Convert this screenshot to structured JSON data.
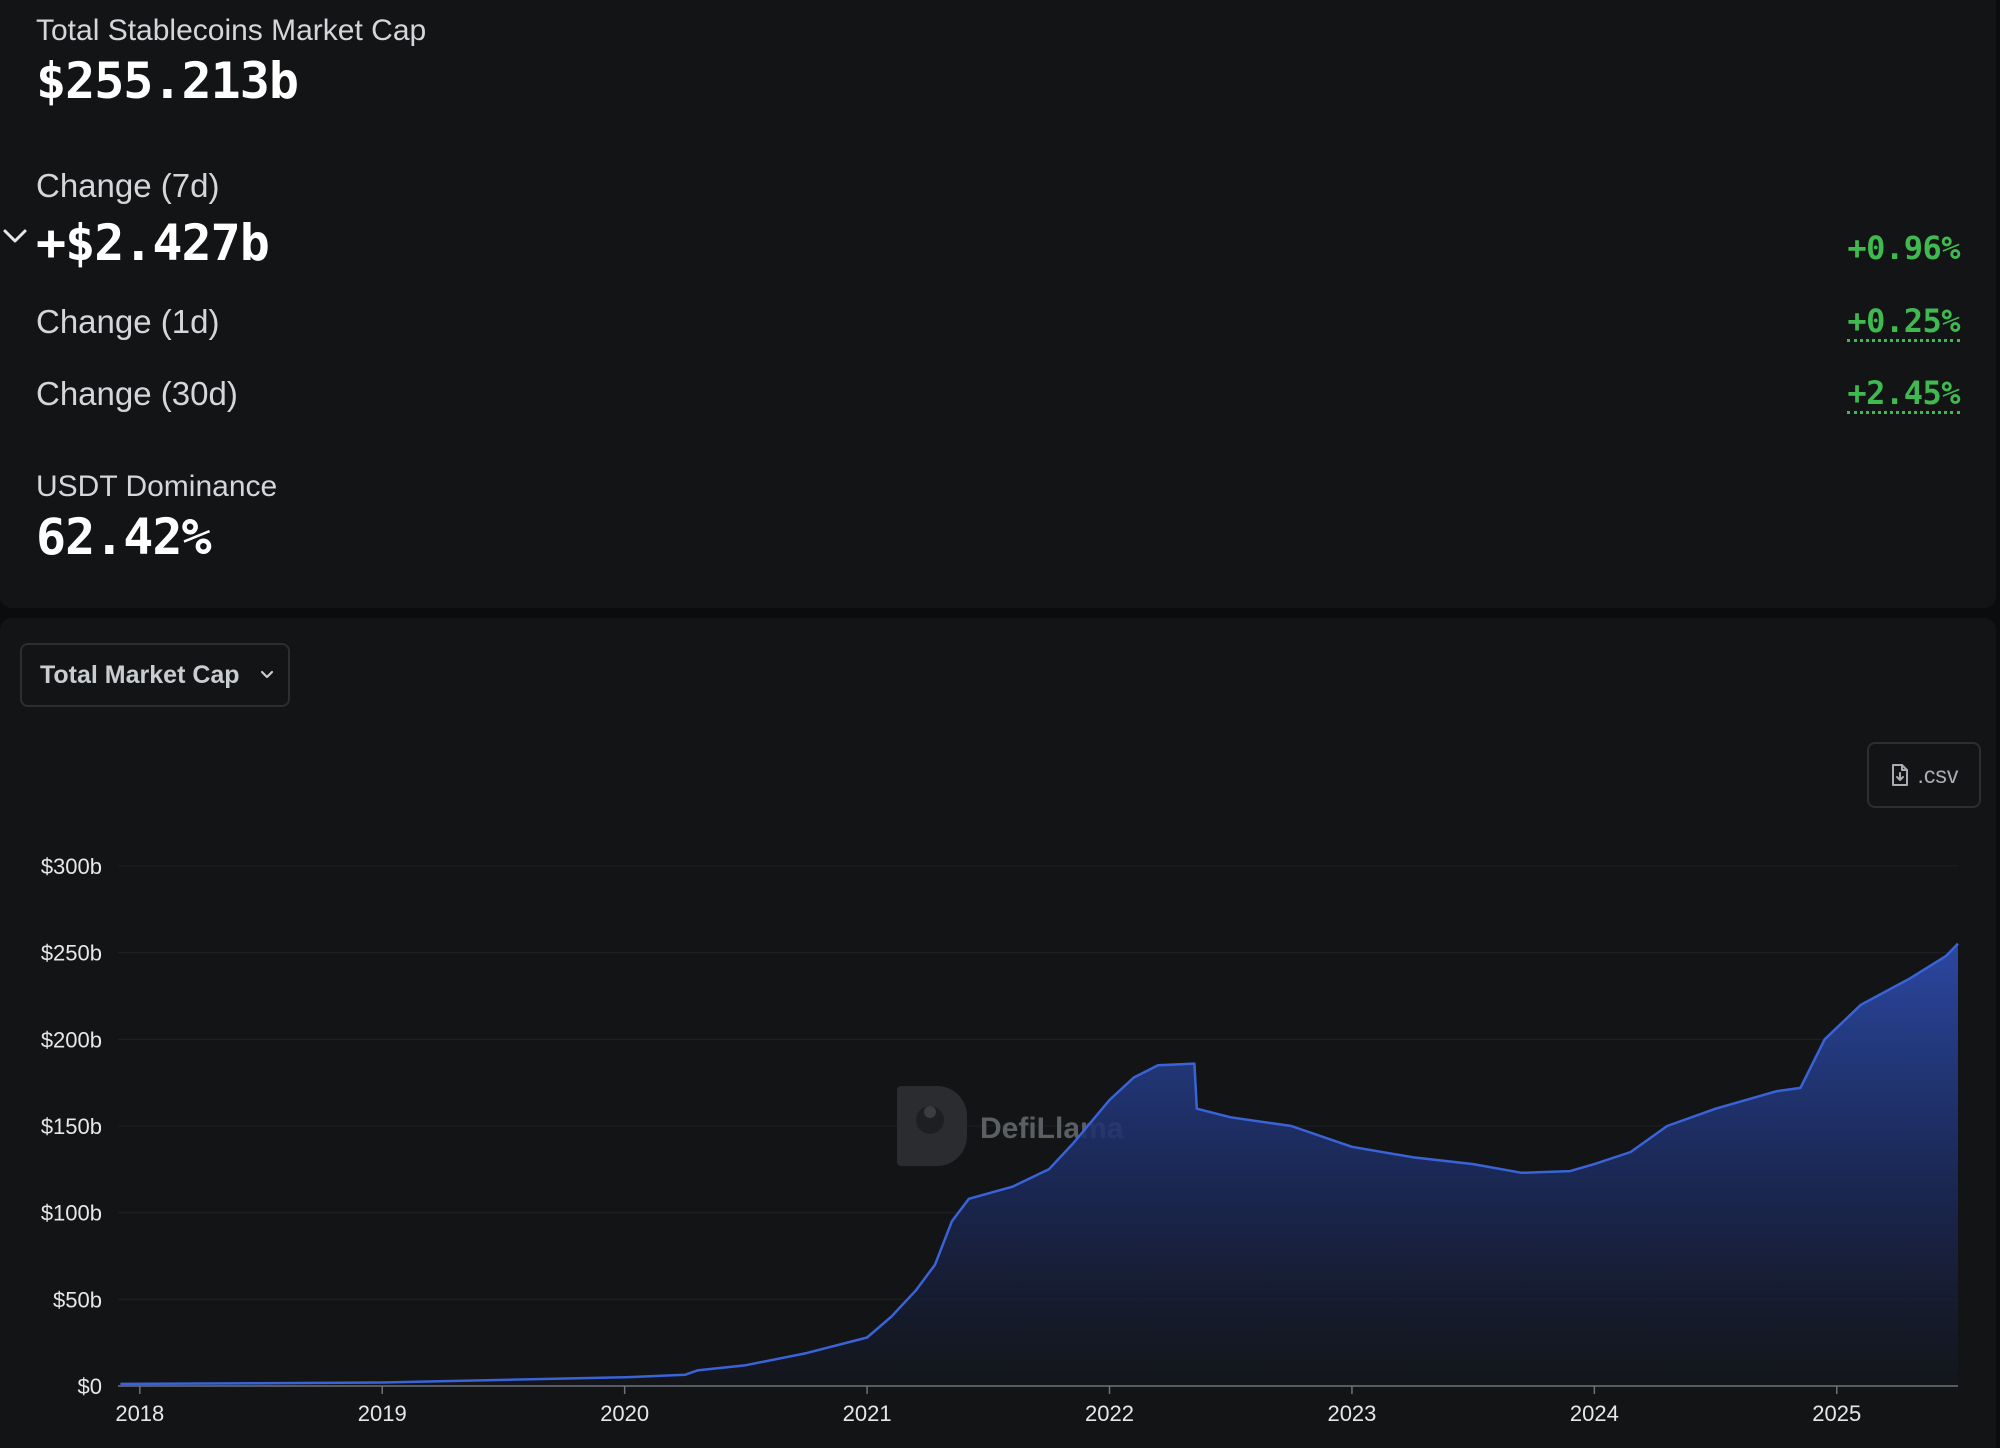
{
  "stats": {
    "total_label": "Total Stablecoins Market Cap",
    "total_value": "$255.213b",
    "change_7d_label": "Change (7d)",
    "change_7d_value": "+$2.427b",
    "change_7d_pct": "+0.96%",
    "change_1d_label": "Change (1d)",
    "change_1d_pct": "+0.25%",
    "change_30d_label": "Change (30d)",
    "change_30d_pct": "+2.45%",
    "dominance_label": "USDT Dominance",
    "dominance_value": "62.42%"
  },
  "controls": {
    "metric_select": "Total Market Cap",
    "csv_label": ".csv"
  },
  "watermark": "DefiLlama",
  "colors": {
    "positive": "#3fb950",
    "line": "#3a63d8",
    "area_top": "#2c4aa8",
    "background": "#131416"
  },
  "icons": [
    "chevron-down-icon",
    "file-download-icon",
    "llama-logo-icon"
  ],
  "chart_data": {
    "type": "area",
    "x_unit": "year",
    "y_unit": "$b",
    "ylim": [
      0,
      300
    ],
    "y_ticks": [
      0,
      50,
      100,
      150,
      200,
      250,
      300
    ],
    "y_tick_labels": [
      "$0",
      "$50b",
      "$100b",
      "$150b",
      "$200b",
      "$250b",
      "$300b"
    ],
    "x_ticks": [
      "2018",
      "2019",
      "2020",
      "2021",
      "2022",
      "2023",
      "2024",
      "2025"
    ],
    "grid": true,
    "series": [
      {
        "points": [
          [
            2017.92,
            1.2
          ],
          [
            2018.5,
            1.6
          ],
          [
            2019.0,
            2.0
          ],
          [
            2019.5,
            3.5
          ],
          [
            2020.0,
            5.0
          ],
          [
            2020.25,
            6.5
          ],
          [
            2020.3,
            9.0
          ],
          [
            2020.5,
            12.0
          ],
          [
            2020.75,
            19.0
          ],
          [
            2021.0,
            28.0
          ],
          [
            2021.1,
            40.0
          ],
          [
            2021.2,
            55.0
          ],
          [
            2021.28,
            70.0
          ],
          [
            2021.35,
            95.0
          ],
          [
            2021.42,
            108.0
          ],
          [
            2021.6,
            115.0
          ],
          [
            2021.75,
            125.0
          ],
          [
            2021.85,
            140.0
          ],
          [
            2022.0,
            165.0
          ],
          [
            2022.1,
            178.0
          ],
          [
            2022.2,
            185.0
          ],
          [
            2022.35,
            186.0
          ],
          [
            2022.36,
            160.0
          ],
          [
            2022.5,
            155.0
          ],
          [
            2022.75,
            150.0
          ],
          [
            2023.0,
            138.0
          ],
          [
            2023.25,
            132.0
          ],
          [
            2023.5,
            128.0
          ],
          [
            2023.7,
            123.0
          ],
          [
            2023.9,
            124.0
          ],
          [
            2024.0,
            128.0
          ],
          [
            2024.15,
            135.0
          ],
          [
            2024.3,
            150.0
          ],
          [
            2024.5,
            160.0
          ],
          [
            2024.75,
            170.0
          ],
          [
            2024.85,
            172.0
          ],
          [
            2024.95,
            200.0
          ],
          [
            2025.1,
            220.0
          ],
          [
            2025.3,
            235.0
          ],
          [
            2025.45,
            248.0
          ],
          [
            2025.5,
            255.213
          ]
        ]
      }
    ]
  }
}
